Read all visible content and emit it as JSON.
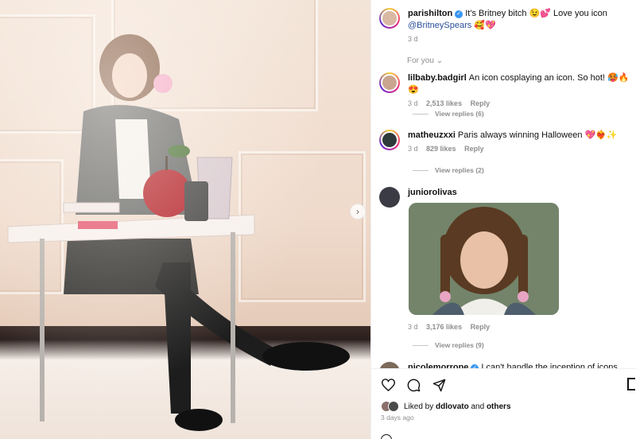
{
  "post": {
    "author": "parishilton",
    "caption_text": "It's Britney bitch 😉💕 Love you icon",
    "caption_mention": "@BritneySpears",
    "caption_emoji": "🥰💖",
    "time": "3 d"
  },
  "filter_label": "For you",
  "comments": [
    {
      "user": "lilbaby.badgirl",
      "text": "An icon cosplaying an icon. So hot! 🥵🔥😍",
      "time": "3 d",
      "likes": "2,513 likes",
      "reply": "Reply",
      "view_replies": "View replies (6)"
    },
    {
      "user": "matheuzxxi",
      "text": "Paris always winning Halloween 💖❤️‍🔥✨",
      "time": "3 d",
      "likes": "829 likes",
      "reply": "Reply",
      "view_replies": "View replies (2)"
    },
    {
      "user": "juniorolivas",
      "text": "",
      "time": "3 d",
      "likes": "3,176 likes",
      "reply": "Reply",
      "view_replies": "View replies (9)"
    },
    {
      "user": "nicolemorrone",
      "text": "I can't handle the inception of icons"
    }
  ],
  "liked_by": {
    "prefix": "Liked by",
    "user": "ddlovato",
    "and": "and",
    "others": "others"
  },
  "posted_ago": "3 days ago",
  "icons": [
    "heart-icon",
    "comment-icon",
    "share-icon",
    "bookmark-icon",
    "verified-icon",
    "chevron-down-icon",
    "chevron-right-icon"
  ]
}
